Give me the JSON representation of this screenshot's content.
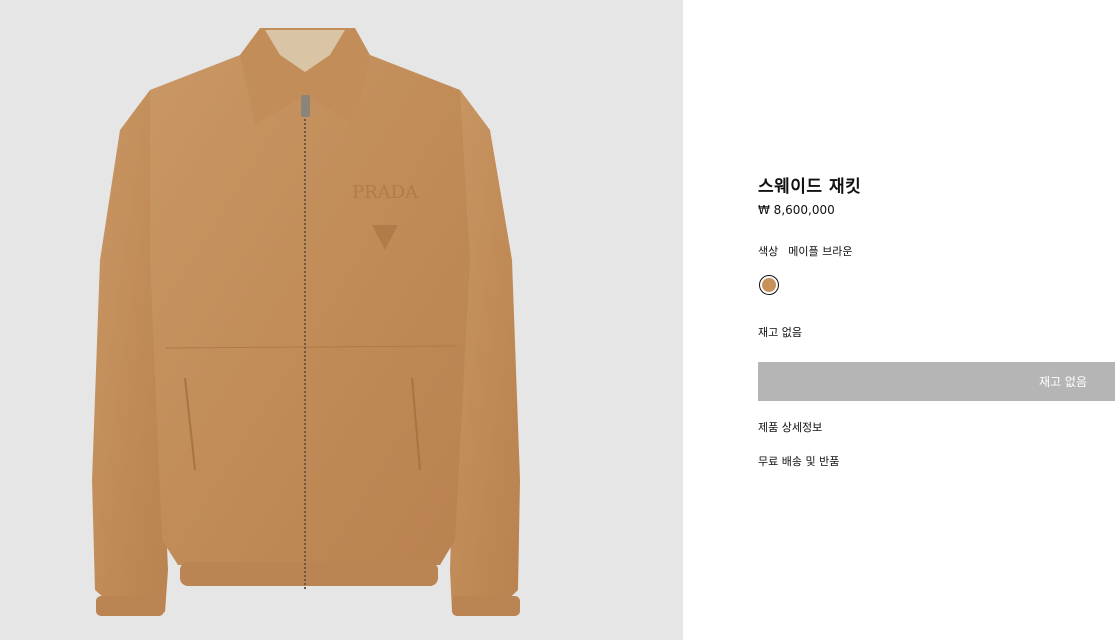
{
  "product": {
    "title": "스웨이드 재킷",
    "price": "₩ 8,600,000",
    "color_label": "색상",
    "color_value": "메이플 브라운",
    "swatch_color": "#c8915a",
    "stock_status": "재고 없음",
    "button_label": "재고 없음",
    "button_color": "#b5b5b5",
    "links": {
      "details": "제품 상세정보",
      "shipping": "무료 배송 및 반품"
    }
  },
  "gallery": {
    "background": "#e6e6e7",
    "image": "suede-jacket-photo",
    "brand_label": "PRADA"
  }
}
